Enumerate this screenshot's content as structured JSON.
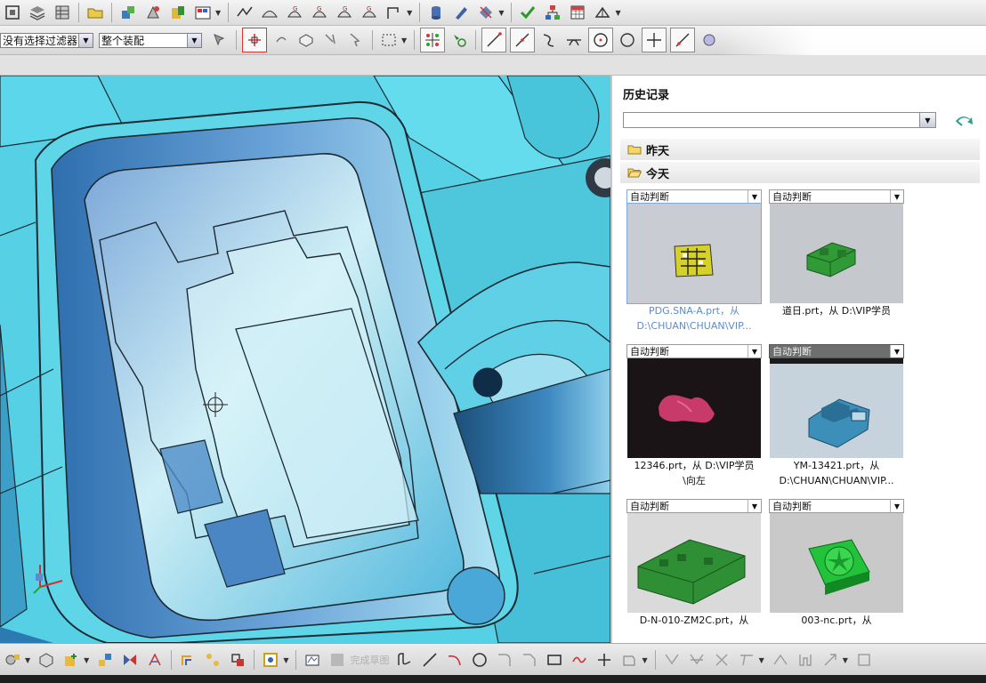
{
  "toolbar_top": {
    "icons": [
      "view-orient-icon",
      "layer-icon",
      "layer-settings-icon",
      "open-icon",
      "assembly-icon",
      "component-icon",
      "add-component-icon",
      "format-icon",
      "sketch-icon",
      "surface-icon",
      "geometry-g-icon",
      "geometry-h-icon",
      "geometry-g2-icon",
      "geometry-h2-icon",
      "route-icon",
      "database-icon",
      "rename-icon",
      "analysis-icon",
      "check-icon",
      "structure-icon",
      "spreadsheet-icon",
      "part-nav-icon"
    ]
  },
  "selection_bar": {
    "filter_value": "没有选择过滤器",
    "scope_value": "整个装配"
  },
  "history": {
    "title": "历史记录",
    "filter_value": "",
    "groups": [
      {
        "label": "昨天"
      },
      {
        "label": "今天"
      }
    ],
    "cards": [
      {
        "mode": "自动判断",
        "caption_line1": "PDG.SNA-A.prt，从",
        "caption_line2": "D:\\CHUAN\\CHUAN\\VIP..."
      },
      {
        "mode": "自动判断",
        "caption_line1": "道日.prt，从 D:\\VIP学员",
        "caption_line2": ""
      },
      {
        "mode": "自动判断",
        "caption_line1": "12346.prt，从 D:\\VIP学员",
        "caption_line2": "\\向左"
      },
      {
        "mode": "自动判断",
        "caption_line1": "YM-13421.prt，从",
        "caption_line2": "D:\\CHUAN\\CHUAN\\VIP..."
      },
      {
        "mode": "自动判断",
        "caption_line1": "D-N-010-ZM2C.prt，从",
        "caption_line2": ""
      },
      {
        "mode": "自动判断",
        "caption_line1": "003-nc.prt，从",
        "caption_line2": ""
      }
    ]
  },
  "bottom_toolbar": {
    "finish_sketch_label": "完成草图"
  },
  "colors": {
    "viewport_cyan": "#56d0e4",
    "part_blue": "#3f8fc8",
    "outline": "#1c2a33",
    "selected_caption": "#5a8ccf"
  }
}
